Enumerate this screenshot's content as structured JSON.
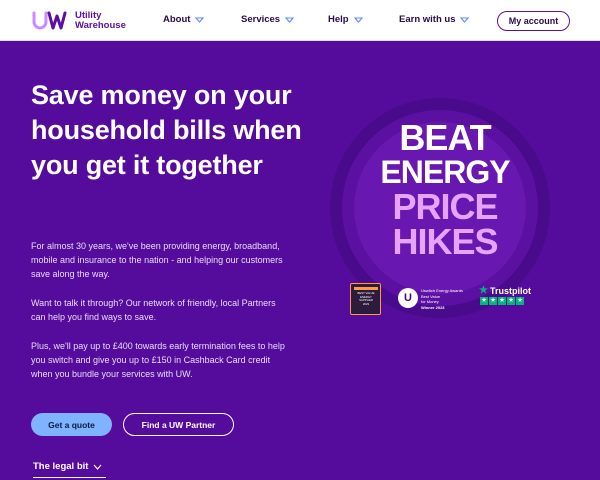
{
  "header": {
    "logo_line1": "Utility",
    "logo_line2": "Warehouse",
    "nav": [
      "About",
      "Services",
      "Help",
      "Earn with us"
    ],
    "account_label": "My account"
  },
  "hero": {
    "title": "Save money on your household bills when you get it together",
    "paragraph1": "For almost 30 years, we've been providing energy, broadband, mobile and insurance to the nation - and helping our customers save along the way.",
    "paragraph2": "Want to talk it through? Our network of friendly, local Partners can help you find ways to save.",
    "paragraph3": "Plus, we'll pay up to £400 towards early termination fees to help you switch and give you up to £150 in Cashback Card credit when you bundle your services with UW.",
    "quote_button": "Get a quote",
    "partner_button": "Find a UW Partner",
    "legal_toggle": "The legal bit"
  },
  "badge": {
    "line1": "BEAT",
    "line2": "ENERGY",
    "line3": "PRICE",
    "line4": "HIKES"
  },
  "awards": {
    "uswitch_line1": "Uswitch Energy Awards",
    "uswitch_line2": "Best Value",
    "uswitch_line3": "for Money",
    "uswitch_winner": "Winner 2023",
    "uswitch_letter": "U",
    "trustpilot_label": "Trustpilot",
    "award1_line1": "BEST VALUE",
    "award1_line2": "ENERGY SUPPLIER",
    "award1_line3": "2023"
  },
  "colors": {
    "primary_purple": "#550b9b",
    "accent_pink": "#e7a4ff",
    "quote_button_blue": "#7fb2ff",
    "trustpilot_green": "#00b67a"
  }
}
